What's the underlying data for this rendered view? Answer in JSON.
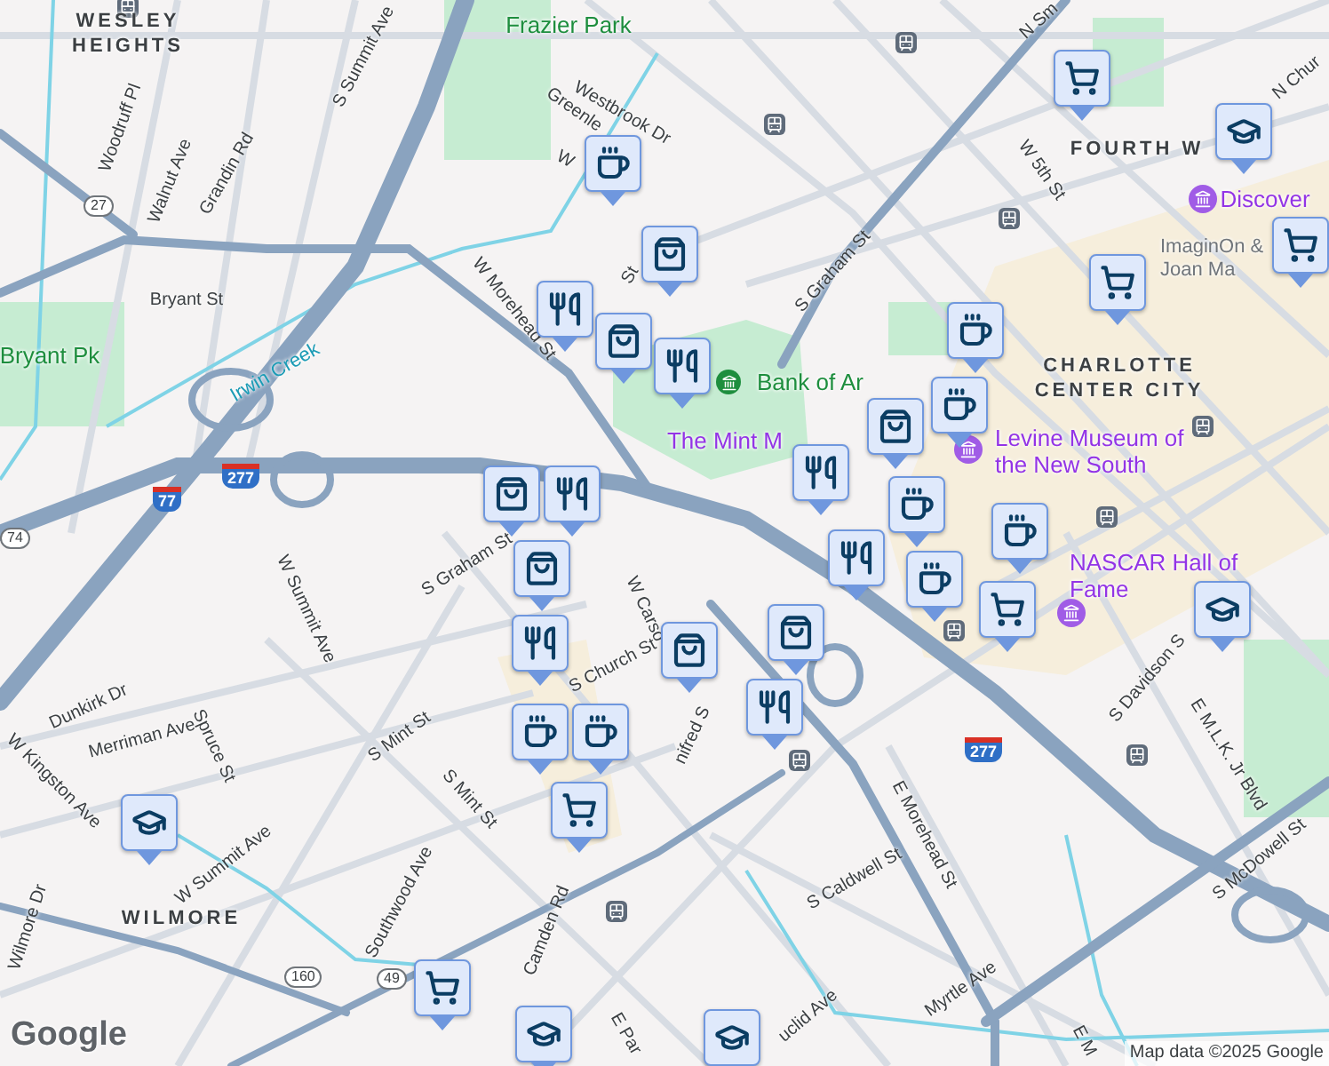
{
  "map": {
    "labels": [
      {
        "text": "WESLEY HEIGHTS",
        "kind": "area"
      },
      {
        "text": "Frazier Park",
        "kind": "park"
      },
      {
        "text": "Bryant Pk",
        "kind": "park"
      },
      {
        "text": "Irwin Creek",
        "kind": "water"
      },
      {
        "text": "S Summit Ave",
        "kind": "street"
      },
      {
        "text": "Woodruff Pl",
        "kind": "street"
      },
      {
        "text": "Walnut Ave",
        "kind": "street"
      },
      {
        "text": "Grandin Rd",
        "kind": "street"
      },
      {
        "text": "Westbrook Dr",
        "kind": "street"
      },
      {
        "text": "Greenle",
        "kind": "street"
      },
      {
        "text": "W",
        "kind": "street"
      },
      {
        "text": "St",
        "kind": "street"
      },
      {
        "text": "Bryant St",
        "kind": "street"
      },
      {
        "text": "W Morehead St",
        "kind": "street"
      },
      {
        "text": "S Graham St",
        "kind": "street"
      },
      {
        "text": "N Sm",
        "kind": "street"
      },
      {
        "text": "W 5th St",
        "kind": "street"
      },
      {
        "text": "FOURTH W",
        "kind": "area"
      },
      {
        "text": "N Chur",
        "kind": "street"
      },
      {
        "text": "Discover",
        "kind": "museum"
      },
      {
        "text": "ImaginOn & Joan Ma",
        "kind": "place"
      },
      {
        "text": "Bank of Ar",
        "kind": "park"
      },
      {
        "text": "CHARLOTTE CENTER CITY",
        "kind": "area"
      },
      {
        "text": "The Mint M",
        "kind": "museum"
      },
      {
        "text": "Levine Museum of the New South",
        "kind": "museum"
      },
      {
        "text": "NASCAR Hall of Fame",
        "kind": "museum"
      },
      {
        "text": "W Summit Ave",
        "kind": "street"
      },
      {
        "text": "S Graham St",
        "kind": "street"
      },
      {
        "text": "W Carso",
        "kind": "street"
      },
      {
        "text": "S Church St",
        "kind": "street"
      },
      {
        "text": "nifred S",
        "kind": "street"
      },
      {
        "text": "Dunkirk Dr",
        "kind": "street"
      },
      {
        "text": "Merriman Ave",
        "kind": "street"
      },
      {
        "text": "W Kingston Ave",
        "kind": "street"
      },
      {
        "text": "Spruce St",
        "kind": "street"
      },
      {
        "text": "S Mint St",
        "kind": "street"
      },
      {
        "text": "W Summit Ave",
        "kind": "street"
      },
      {
        "text": "S Mint St",
        "kind": "street"
      },
      {
        "text": "Southwood Ave",
        "kind": "street"
      },
      {
        "text": "Wilmore Dr",
        "kind": "street"
      },
      {
        "text": "WILMORE",
        "kind": "area"
      },
      {
        "text": "Camden Rd",
        "kind": "street"
      },
      {
        "text": "E Par",
        "kind": "street"
      },
      {
        "text": "S Davidson S",
        "kind": "street"
      },
      {
        "text": "E M.L.K. Jr Blvd",
        "kind": "street"
      },
      {
        "text": "S McDowell St",
        "kind": "street"
      },
      {
        "text": "E Morehead St",
        "kind": "street"
      },
      {
        "text": "S Caldwell St",
        "kind": "street"
      },
      {
        "text": "Myrtle Ave",
        "kind": "street"
      },
      {
        "text": "uclid Ave",
        "kind": "street"
      },
      {
        "text": "E M",
        "kind": "street"
      }
    ],
    "shields": [
      {
        "text": "27",
        "kind": "route"
      },
      {
        "text": "74",
        "kind": "route"
      },
      {
        "text": "77",
        "kind": "interstate"
      },
      {
        "text": "277",
        "kind": "interstate"
      },
      {
        "text": "277",
        "kind": "interstate"
      },
      {
        "text": "160",
        "kind": "route"
      },
      {
        "text": "49",
        "kind": "route"
      }
    ],
    "markers": [
      {
        "kind": "cup"
      },
      {
        "kind": "bag"
      },
      {
        "kind": "fork"
      },
      {
        "kind": "bag"
      },
      {
        "kind": "fork"
      },
      {
        "kind": "cart"
      },
      {
        "kind": "cap"
      },
      {
        "kind": "cart"
      },
      {
        "kind": "cart"
      },
      {
        "kind": "cup"
      },
      {
        "kind": "bag"
      },
      {
        "kind": "cup"
      },
      {
        "kind": "fork"
      },
      {
        "kind": "cup"
      },
      {
        "kind": "fork"
      },
      {
        "kind": "cup"
      },
      {
        "kind": "cup"
      },
      {
        "kind": "cart"
      },
      {
        "kind": "cap"
      },
      {
        "kind": "bag"
      },
      {
        "kind": "fork"
      },
      {
        "kind": "bag"
      },
      {
        "kind": "bag"
      },
      {
        "kind": "fork"
      },
      {
        "kind": "bag"
      },
      {
        "kind": "fork"
      },
      {
        "kind": "cup"
      },
      {
        "kind": "cup"
      },
      {
        "kind": "cart"
      },
      {
        "kind": "cap"
      },
      {
        "kind": "cart"
      },
      {
        "kind": "cap"
      },
      {
        "kind": "cap"
      }
    ],
    "logo": "Google",
    "attribution": "Map data ©2025 Google"
  }
}
